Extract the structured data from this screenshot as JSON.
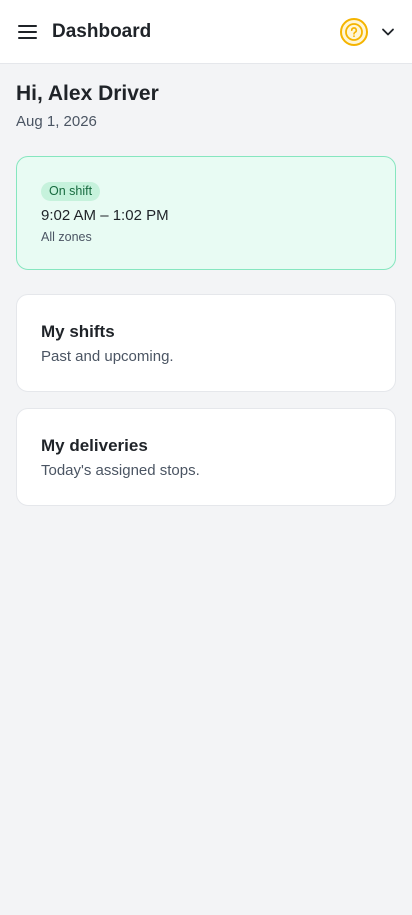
{
  "header": {
    "title": "Dashboard",
    "menu_icon": "hamburger-menu-icon",
    "help_icon": "help-circle-icon",
    "dropdown_icon": "chevron-down-icon"
  },
  "greeting": {
    "title": "Hi, Alex Driver",
    "date": "Aug 1, 2026"
  },
  "shift_status": {
    "badge": "On shift",
    "time_range": "9:02 AM – 1:02 PM",
    "zone": "All zones"
  },
  "cards": {
    "shifts": {
      "title": "My shifts",
      "subtitle": "Past and upcoming."
    },
    "deliveries": {
      "title": "My deliveries",
      "subtitle": "Today's assigned stops."
    }
  },
  "colors": {
    "accent_help": "#f5b400",
    "shift_card_bg": "#e8fbf3",
    "shift_card_border": "#86e6bf",
    "badge_bg": "#c6f2dc",
    "badge_text": "#176b3f",
    "page_bg": "#f3f4f6"
  }
}
